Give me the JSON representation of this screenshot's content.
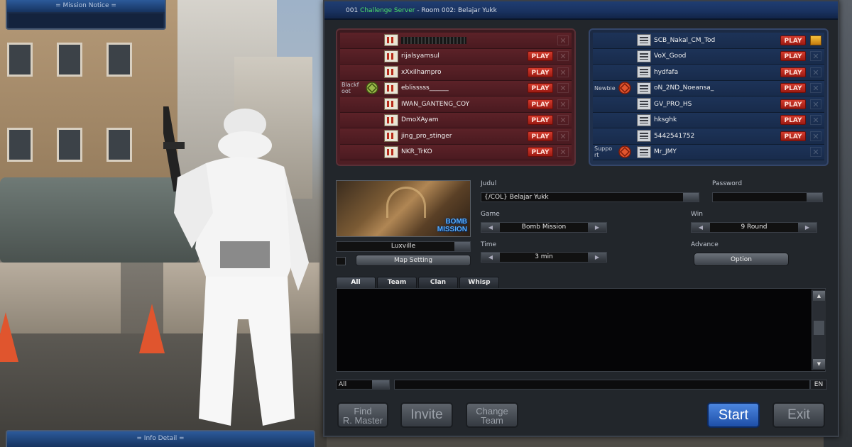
{
  "panels": {
    "mission_notice": "= Mission Notice =",
    "info_detail": "= Info Detail ="
  },
  "room": {
    "title_prefix": "001",
    "server": "Challenge Server",
    "title_suffix": "- Room 002:  Belajar Yukk"
  },
  "red_team": [
    {
      "clan": "",
      "name": "",
      "play": "",
      "hidden": true
    },
    {
      "clan": "",
      "name": "rijalsyamsul",
      "play": "PLAY"
    },
    {
      "clan": "",
      "name": "xXxilhampro",
      "play": "PLAY"
    },
    {
      "clan": "Blackf oot",
      "name": "eblisssss______",
      "play": "PLAY",
      "clan_icon": "clan-emblem-icon"
    },
    {
      "clan": "",
      "name": "IWAN_GANTENG_COY",
      "play": "PLAY"
    },
    {
      "clan": "",
      "name": "DmoXAyam",
      "play": "PLAY"
    },
    {
      "clan": "",
      "name": "jing_pro_stinger",
      "play": "PLAY"
    },
    {
      "clan": "",
      "name": "NKR_TrKO",
      "play": "PLAY"
    }
  ],
  "blue_team": [
    {
      "clan": "",
      "name": "SCB_Nakal_CM_Tod",
      "play": "PLAY",
      "host": true
    },
    {
      "clan": "",
      "name": "VoX_Good",
      "play": "PLAY"
    },
    {
      "clan": "",
      "name": "hydfafa",
      "play": "PLAY"
    },
    {
      "clan": "Newbie",
      "name": "oN_2ND_Noeansa_",
      "play": "PLAY",
      "clan_icon": "clan-emblem-icon"
    },
    {
      "clan": "",
      "name": "GV_PRO_HS",
      "play": "PLAY"
    },
    {
      "clan": "",
      "name": "hksghk",
      "play": "PLAY"
    },
    {
      "clan": "",
      "name": "5442541752",
      "play": "PLAY"
    },
    {
      "clan": "Suppo rt",
      "name": "Mr_JMY",
      "play": "",
      "clan_icon": "clan-emblem-icon"
    }
  ],
  "map": {
    "name": "Luxville",
    "thumb_tag_1": "BOMB",
    "thumb_tag_2": "MISSION",
    "setting_label": "Map Setting"
  },
  "settings": {
    "judul_label": "Judul",
    "judul_value": "{/COL} Belajar Yukk",
    "password_label": "Password",
    "password_value": "",
    "game_label": "Game",
    "game_value": "Bomb Mission",
    "win_label": "Win",
    "win_value": "9 Round",
    "time_label": "Time",
    "time_value": "3 min",
    "advance_label": "Advance",
    "option_label": "Option"
  },
  "chat": {
    "tabs": [
      "All",
      "Team",
      "Clan",
      "Whisp"
    ],
    "active_tab": "All",
    "target": "All",
    "lang": "EN"
  },
  "buttons": {
    "find_line1": "Find",
    "find_line2": "R. Master",
    "invite": "Invite",
    "change_line1": "Change",
    "change_line2": "Team",
    "start": "Start",
    "exit": "Exit"
  },
  "colors": {
    "server_green": "#4ce06a",
    "play_red": "#d43a2c",
    "start_blue": "#3a74d0",
    "red_team_bg": "#4e1e24",
    "blue_team_bg": "#21324f"
  }
}
